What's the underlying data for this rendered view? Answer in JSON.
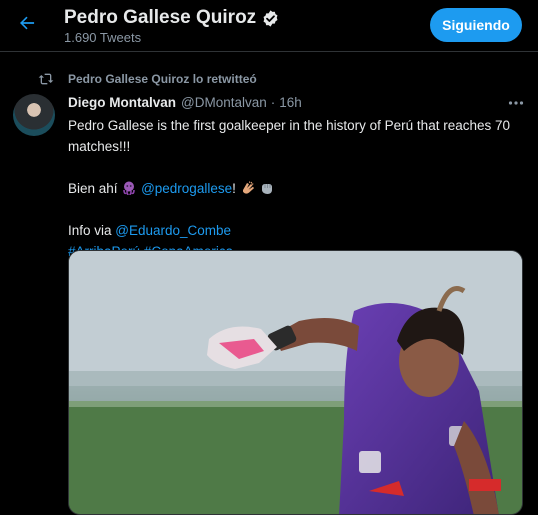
{
  "header": {
    "title": "Pedro Gallese Quiroz",
    "tweet_count": "1.690 Tweets",
    "follow_label": "Siguiendo"
  },
  "retweet": {
    "label": "Pedro Gallese Quiroz lo retwitteó"
  },
  "tweet": {
    "author_name": "Diego Montalvan",
    "author_handle": "@DMontalvan",
    "separator": "·",
    "time": "16h",
    "line1": "Pedro Gallese is the first goalkeeper in the history of Perú that reaches 70 matches!!!",
    "line2_prefix": "Bien ahí",
    "mention1": "@pedrogallese",
    "line2_exclaim": "!",
    "info_prefix": "Info via",
    "mention2": "@Eduardo_Combe",
    "hashtag1": "#ArribaPerú",
    "hashtag2": "#CopaAmerica"
  },
  "icons": {
    "back": "arrow-left-icon",
    "verified": "verified-badge-icon",
    "retweet": "retweet-icon",
    "more": "more-options-icon",
    "emojis": [
      "octopus-emoji",
      "clapping-hands-emoji",
      "fist-emoji"
    ]
  },
  "colors": {
    "accent": "#1d9bf0",
    "background": "#000000",
    "muted_text": "#8b98a5",
    "primary_text": "#e7e9ea"
  }
}
